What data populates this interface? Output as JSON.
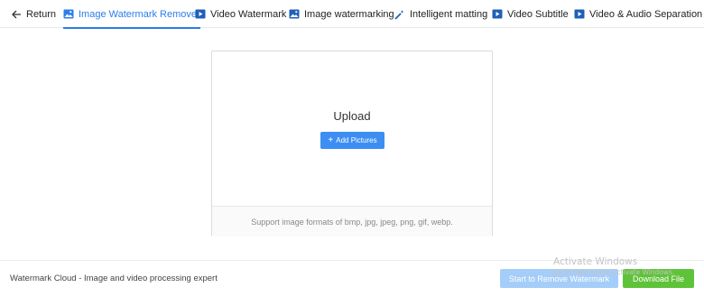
{
  "nav": {
    "return_label": "Return",
    "tabs": [
      {
        "label": "Image Watermark Remover",
        "icon": "image-icon",
        "active": true
      },
      {
        "label": "Video Watermark",
        "icon": "video-icon",
        "active": false
      },
      {
        "label": "Image watermarking",
        "icon": "image-icon",
        "active": false
      },
      {
        "label": "Intelligent matting",
        "icon": "magic-wand-icon",
        "active": false
      },
      {
        "label": "Video Subtitle",
        "icon": "video-icon",
        "active": false
      },
      {
        "label": "Video & Audio Separation",
        "icon": "video-icon",
        "active": false
      }
    ]
  },
  "upload": {
    "title": "Upload",
    "add_button": "Add Pictures",
    "formats_hint": "Support image formats of bmp, jpg, jpeg, png, gif, webp."
  },
  "footer": {
    "tagline": "Watermark Cloud - Image and video processing expert",
    "remove_button": "Start to Remove Watermark",
    "download_button": "Download File"
  },
  "os_watermark": {
    "line1": "Activate Windows",
    "line2": "Go to Settings to activate Windows."
  },
  "colors": {
    "accent": "#2b7de9",
    "primary_button": "#3d8ef2",
    "disabled_button": "#a5cdf9",
    "success_button": "#5fc33a"
  }
}
